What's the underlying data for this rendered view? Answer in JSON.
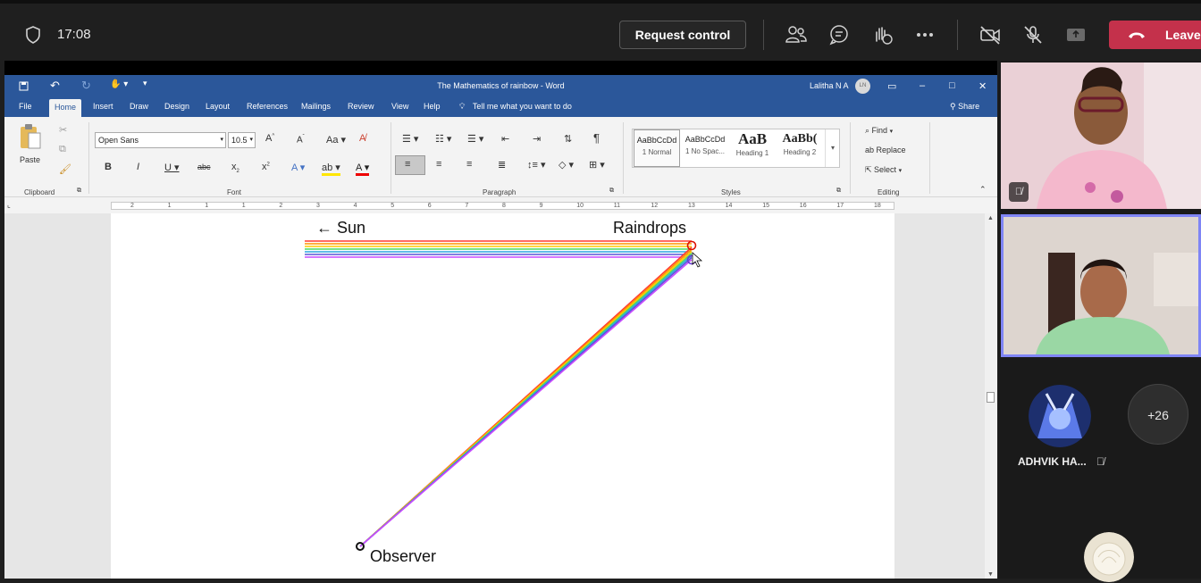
{
  "meeting": {
    "time": "17:08",
    "request_control_label": "Request control",
    "leave_label": "Leave"
  },
  "word": {
    "window_title": "The Mathematics of rainbow  -  Word",
    "user_name": "Lalitha N A",
    "user_initials": "LN",
    "tabs": [
      "File",
      "Home",
      "Insert",
      "Draw",
      "Design",
      "Layout",
      "References",
      "Mailings",
      "Review",
      "View",
      "Help"
    ],
    "tell_me": "Tell me what you want to do",
    "share_label": "Share",
    "ribbon": {
      "paste_label": "Paste",
      "font_name": "Open Sans",
      "font_size": "10.5",
      "styles": [
        {
          "sample": "AaBbCcDd",
          "name": "1 Normal"
        },
        {
          "sample": "AaBbCcDd",
          "name": "1 No Spac..."
        },
        {
          "sample": "AaB",
          "name": "Heading 1"
        },
        {
          "sample": "AaBb(",
          "name": "Heading 2"
        }
      ],
      "find_label": "Find",
      "replace_label": "Replace",
      "select_label": "Select",
      "groups": {
        "clipboard": "Clipboard",
        "font": "Font",
        "paragraph": "Paragraph",
        "styles": "Styles",
        "editing": "Editing"
      }
    },
    "ruler_numbers": [
      "2",
      "1",
      "1",
      "1",
      "2",
      "3",
      "4",
      "5",
      "6",
      "7",
      "8",
      "9",
      "10",
      "11",
      "12",
      "13",
      "14",
      "15",
      "16",
      "17",
      "18"
    ],
    "document": {
      "sun_label": "← Sun",
      "raindrops_label": "Raindrops",
      "observer_label": "Observer"
    },
    "rainbow_colors": [
      "#ff3b30",
      "#ff9500",
      "#ffcc00",
      "#4cd964",
      "#2ea7e0",
      "#5856d6",
      "#c94bff"
    ]
  },
  "participants": {
    "named": "ADHVIK HA...",
    "overflow_count": "+26"
  },
  "colors": {
    "teams_bg": "#1f1f1f",
    "leave_red": "#c4314b",
    "word_blue": "#2b579a",
    "active_speaker": "#7f85f5"
  }
}
